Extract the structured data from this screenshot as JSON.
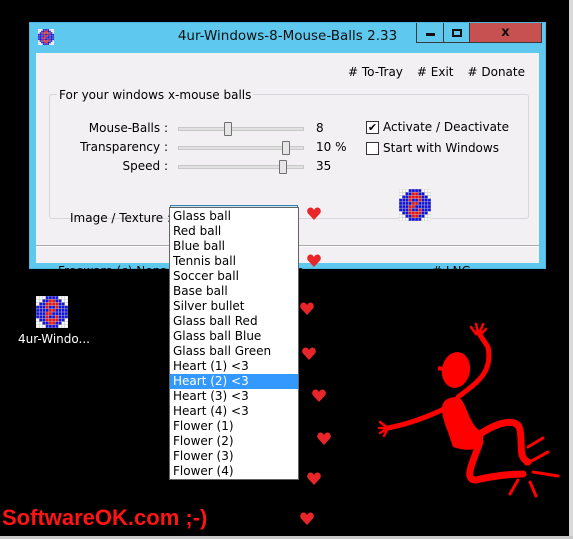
{
  "window": {
    "title": "4ur-Windows-8-Mouse-Balls 2.33",
    "controls": {
      "minimize": "minimize",
      "maximize": "maximize",
      "close": "x"
    }
  },
  "toplinks": [
    "# To-Tray",
    "# Exit",
    "# Donate"
  ],
  "group": {
    "label": "For your windows x-mouse balls",
    "sliders": [
      {
        "label": "Mouse-Balls :",
        "value_text": "8",
        "position": 0.39
      },
      {
        "label": "Transparency :",
        "value_text": "10 %",
        "position": 0.88
      },
      {
        "label": "Speed :",
        "value_text": "35",
        "position": 0.86
      }
    ],
    "checkboxes": [
      {
        "label": "Activate / Deactivate",
        "checked": true,
        "mark": "✔"
      },
      {
        "label": "Start with Windows",
        "checked": false,
        "mark": ""
      }
    ],
    "combo": {
      "label": "Image / Texture :",
      "selected": "Heart (2) <3",
      "chevron": "⌄"
    }
  },
  "footer": {
    "text": "Freeware (c) Nenad Hrg SoftwareOK.com",
    "lng": "# LNG"
  },
  "dropdown": {
    "items": [
      "Glass ball",
      "Red ball",
      "Blue ball",
      "Tennis ball",
      "Soccer ball",
      "Base ball",
      "Silver bullet",
      "Glass ball Red",
      "Glass ball Blue",
      "Glass ball Green",
      "Heart (1) <3",
      "Heart (2) <3",
      "Heart (3) <3",
      "Heart (4) <3",
      "Flower (1)",
      "Flower (2)",
      "Flower (3)",
      "Flower (4)"
    ],
    "selected_index": 11
  },
  "desktop": {
    "icon_label": "4ur-Windo..."
  },
  "brand_text": "SoftwareOK.com ;-)",
  "colors": {
    "titlebar": "#5ec8ee",
    "close": "#c75050",
    "selection": "#3399ff",
    "heart": "#e8262a",
    "brand": "#ff1414"
  }
}
